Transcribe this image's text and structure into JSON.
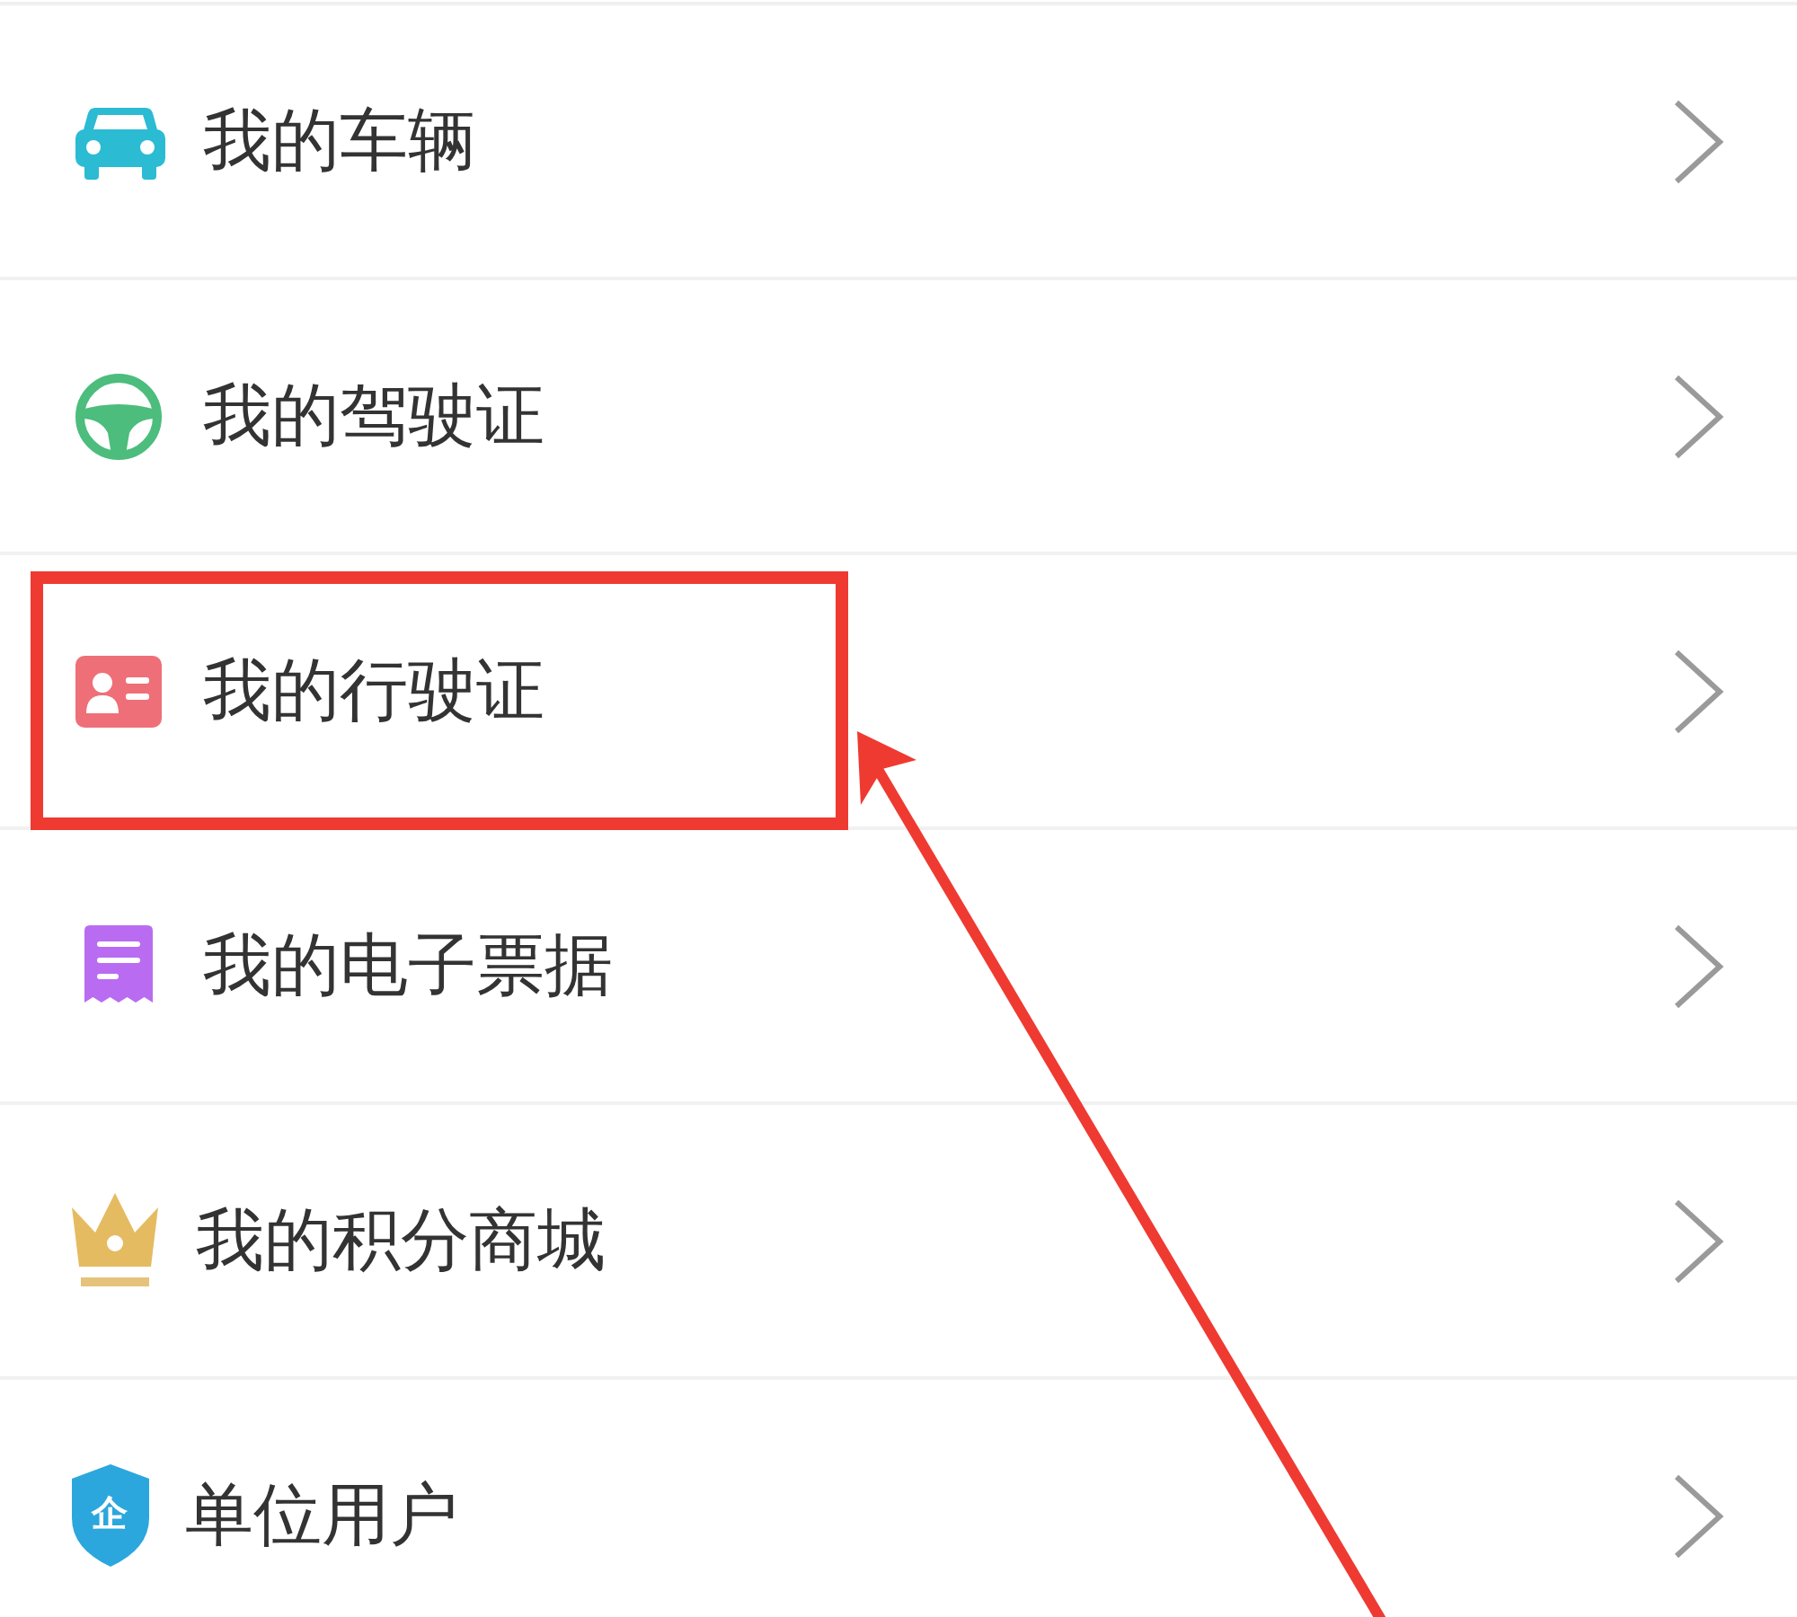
{
  "menu": {
    "items": [
      {
        "label": "我的车辆",
        "highlighted": false
      },
      {
        "label": "我的驾驶证",
        "highlighted": false
      },
      {
        "label": "我的行驶证",
        "highlighted": true
      },
      {
        "label": "我的电子票据",
        "highlighted": false
      },
      {
        "label": "我的积分商城",
        "highlighted": false
      },
      {
        "label": "单位用户",
        "icon_label": "企",
        "highlighted": false
      }
    ]
  }
}
